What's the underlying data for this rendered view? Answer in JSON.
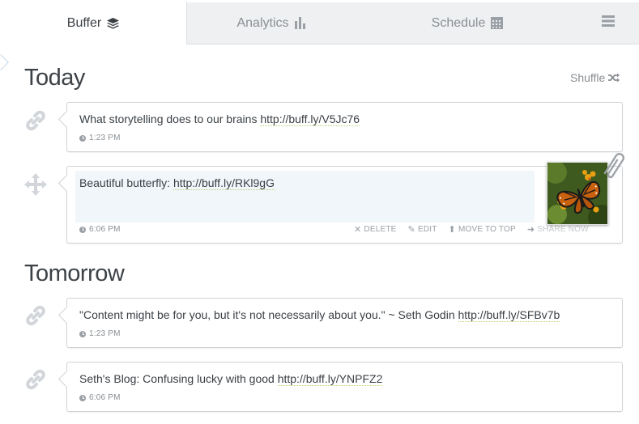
{
  "tabs": [
    {
      "label": "Buffer",
      "icon": "layers-icon",
      "active": true
    },
    {
      "label": "Analytics",
      "icon": "bar-chart-icon",
      "active": false
    },
    {
      "label": "Schedule",
      "icon": "calendar-icon",
      "active": false
    },
    {
      "label": "",
      "icon": "menu-icon",
      "active": false
    }
  ],
  "today": {
    "title": "Today",
    "shuffle_label": "Shuffle",
    "posts": [
      {
        "text": "What storytelling does to our brains ",
        "link": "http://buff.ly/V5Jc76",
        "time": "1:23 PM",
        "side_icon": "link-icon"
      },
      {
        "text": "Beautiful butterfly: ",
        "link": "http://buff.ly/RKl9gG",
        "time": "6:06 PM",
        "side_icon": "move-icon",
        "actions": {
          "delete": "DELETE",
          "edit": "EDIT",
          "move_to_top": "MOVE TO TOP",
          "share_now": "SHARE NOW"
        },
        "image": "butterfly-thumbnail"
      }
    ]
  },
  "tomorrow": {
    "title": "Tomorrow",
    "posts": [
      {
        "text": "\"Content might be for you, but it's not necessarily about you.\" ~ Seth Godin ",
        "link": "http://buff.ly/SFBv7b",
        "time": "1:23 PM",
        "side_icon": "link-icon"
      },
      {
        "text": "Seth's Blog: Confusing lucky with good ",
        "link": "http://buff.ly/YNPFZ2",
        "time": "6:06 PM",
        "side_icon": "link-icon"
      }
    ]
  },
  "colors": {
    "link_underline": "#b8d36b",
    "highlight": "#f1f6fb",
    "muted": "#8a8f94"
  }
}
